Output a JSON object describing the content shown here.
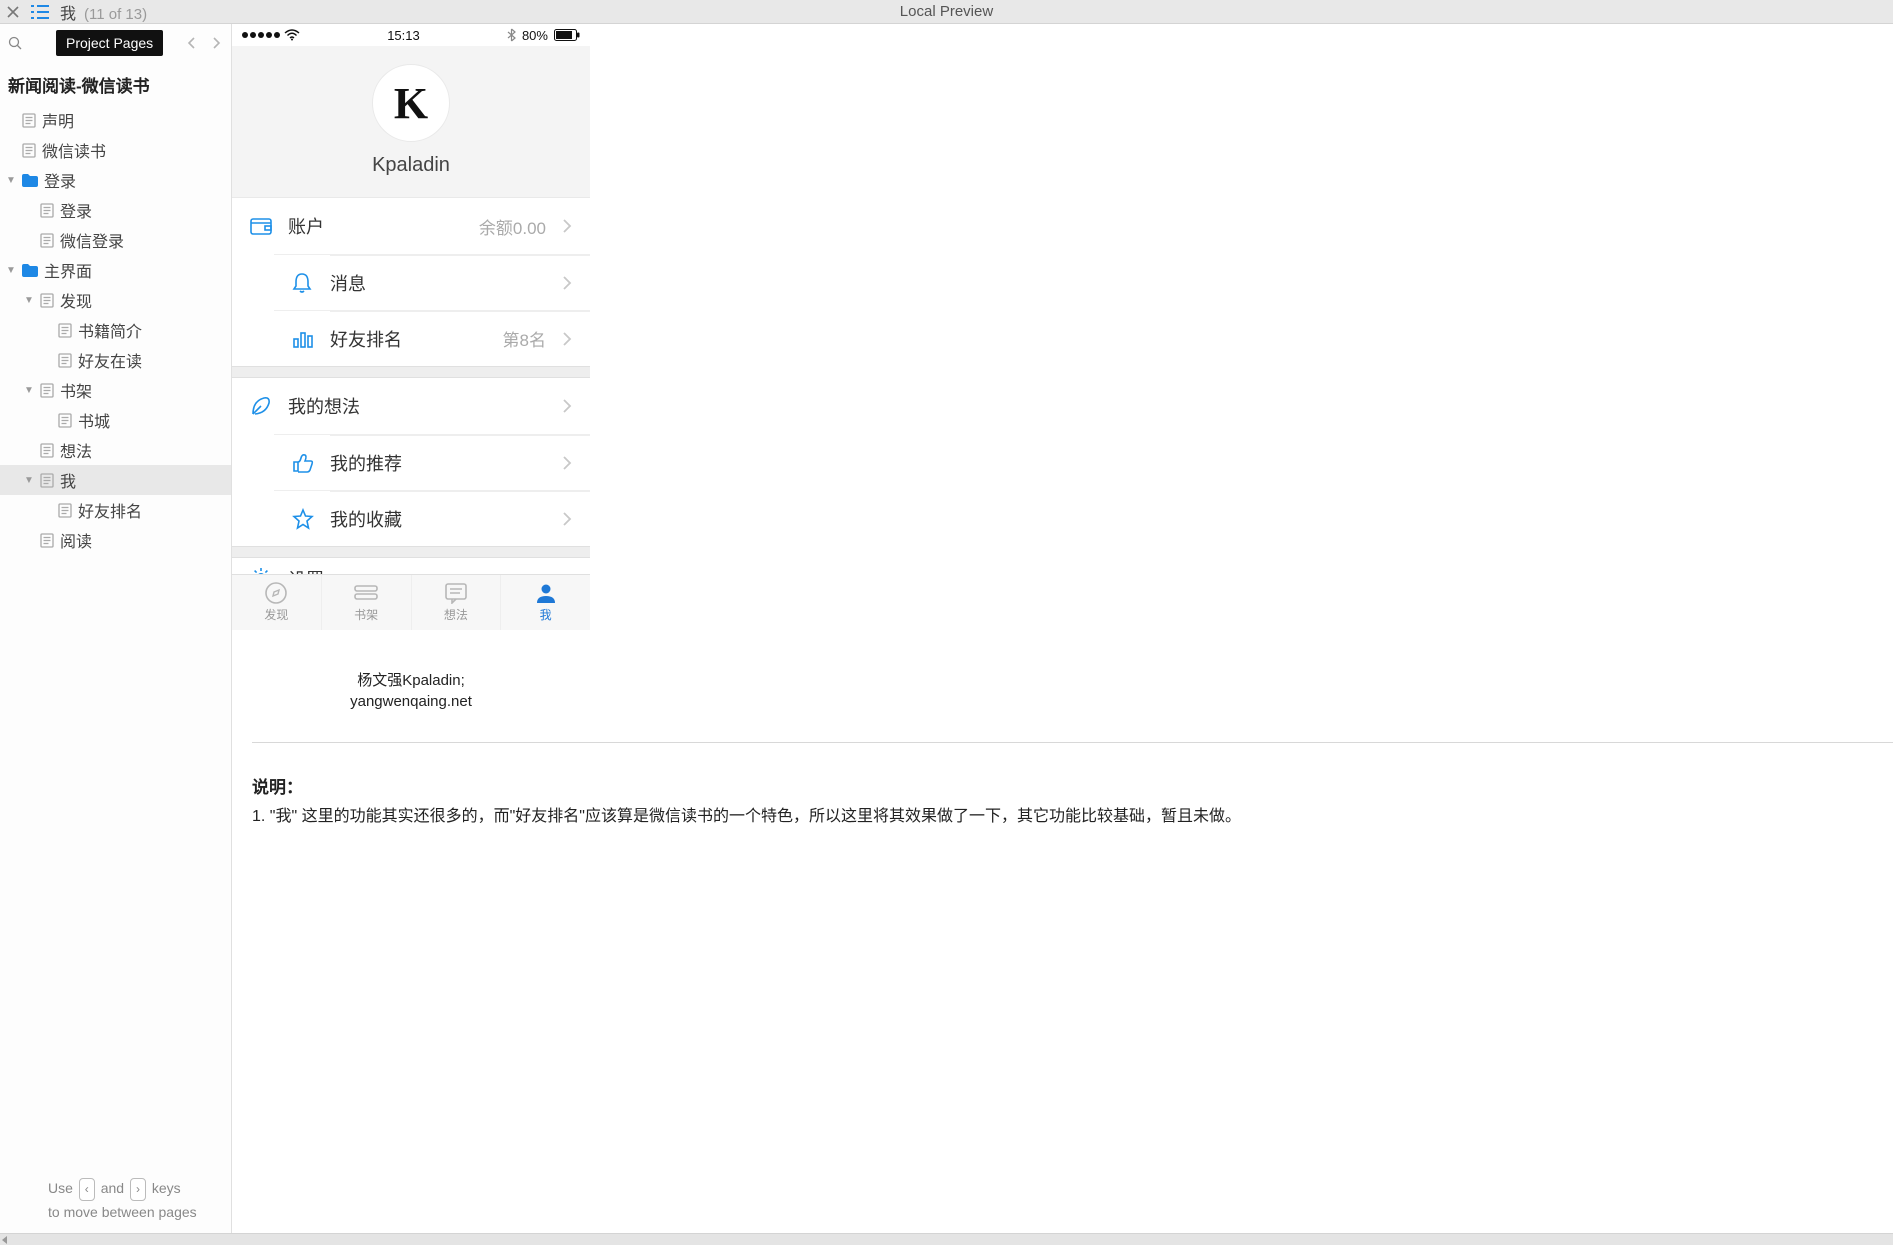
{
  "topbar": {
    "title": "我",
    "count": "(11 of 13)",
    "center": "Local Preview",
    "tooltip": "Project Pages"
  },
  "sidebar": {
    "project_title": "新闻阅读-微信读书",
    "footer1": "Use",
    "kbd1": "‹",
    "footer2": "and",
    "kbd2": "›",
    "footer3": "keys",
    "footer4": "to move between pages",
    "items": [
      {
        "indent": 0,
        "twisty": "none",
        "type": "page",
        "label": "声明"
      },
      {
        "indent": 0,
        "twisty": "none",
        "type": "page",
        "label": "微信读书"
      },
      {
        "indent": 0,
        "twisty": "open",
        "type": "folder",
        "label": "登录"
      },
      {
        "indent": 1,
        "twisty": "none",
        "type": "page",
        "label": "登录"
      },
      {
        "indent": 1,
        "twisty": "none",
        "type": "page",
        "label": "微信登录"
      },
      {
        "indent": 0,
        "twisty": "open",
        "type": "folder",
        "label": "主界面"
      },
      {
        "indent": 1,
        "twisty": "open",
        "type": "page",
        "label": "发现"
      },
      {
        "indent": 2,
        "twisty": "none",
        "type": "page",
        "label": "书籍简介"
      },
      {
        "indent": 2,
        "twisty": "none",
        "type": "page",
        "label": "好友在读"
      },
      {
        "indent": 1,
        "twisty": "open",
        "type": "page",
        "label": "书架"
      },
      {
        "indent": 2,
        "twisty": "none",
        "type": "page",
        "label": "书城"
      },
      {
        "indent": 1,
        "twisty": "none",
        "type": "page",
        "label": "想法"
      },
      {
        "indent": 1,
        "twisty": "open",
        "type": "page",
        "label": "我",
        "selected": true
      },
      {
        "indent": 2,
        "twisty": "none",
        "type": "page",
        "label": "好友排名"
      },
      {
        "indent": 1,
        "twisty": "none",
        "type": "page",
        "label": "阅读"
      }
    ]
  },
  "phone": {
    "time": "15:13",
    "battery_pct": "80%",
    "username": "Kpaladin",
    "avatar_letter": "K",
    "rows_g1": [
      {
        "icon": "wallet",
        "label": "账户",
        "value": "余额0.00"
      },
      {
        "icon": "bell",
        "label": "消息",
        "value": ""
      },
      {
        "icon": "chart",
        "label": "好友排名",
        "value": "第8名"
      }
    ],
    "rows_g2": [
      {
        "icon": "feather",
        "label": "我的想法",
        "value": ""
      },
      {
        "icon": "thumb",
        "label": "我的推荐",
        "value": ""
      },
      {
        "icon": "star",
        "label": "我的收藏",
        "value": ""
      }
    ],
    "settings_label": "设置",
    "tabs": [
      {
        "icon": "compass",
        "label": "发现"
      },
      {
        "icon": "books",
        "label": "书架"
      },
      {
        "icon": "chat",
        "label": "想法"
      },
      {
        "icon": "person",
        "label": "我",
        "active": true
      }
    ]
  },
  "credits": {
    "line1": "杨文强Kpaladin;",
    "line2": "yangwenqaing.net"
  },
  "desc": {
    "title": "说明：",
    "body": "1. \"我\" 这里的功能其实还很多的，而\"好友排名\"应该算是微信读书的一个特色，所以这里将其效果做了一下，其它功能比较基础，暂且未做。"
  }
}
